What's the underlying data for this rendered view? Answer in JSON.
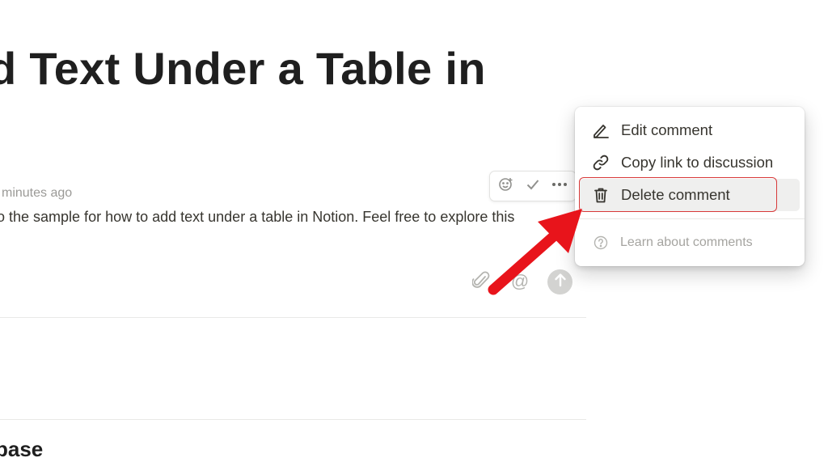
{
  "page": {
    "title": "d Text Under a Table in",
    "section_heading": "pase"
  },
  "comment": {
    "timestamp": "minutes ago",
    "body": "o the sample for how to add text under a table in Notion. Feel free to explore this"
  },
  "comment_toolbar": {
    "icons": [
      "add-reaction-icon",
      "resolve-check-icon",
      "more-options-icon"
    ]
  },
  "reply_bar": {
    "icons": [
      "paperclip-icon",
      "at-mention-icon",
      "send-arrow-icon"
    ],
    "mention_glyph": "@"
  },
  "context_menu": {
    "items": [
      {
        "label": "Edit comment",
        "icon": "pencil-icon"
      },
      {
        "label": "Copy link to discussion",
        "icon": "link-icon"
      },
      {
        "label": "Delete comment",
        "icon": "trash-icon",
        "highlighted": true
      }
    ],
    "help_item": {
      "label": "Learn about comments",
      "icon": "question-circle-icon"
    }
  },
  "annotation": {
    "arrow_color": "#e8141b",
    "highlight_color": "#d83a3a"
  }
}
